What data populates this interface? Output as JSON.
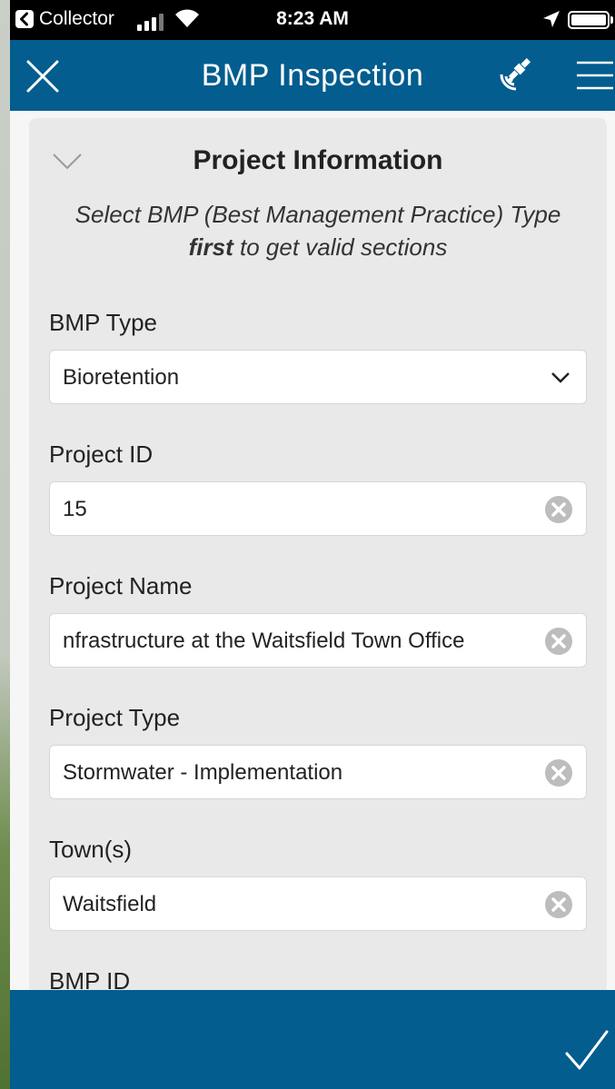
{
  "status_bar": {
    "back_app": "Collector",
    "time": "8:23 AM"
  },
  "nav": {
    "title": "BMP Inspection",
    "close_icon": "close-icon",
    "gps_icon": "gps-satellite-icon",
    "menu_icon": "hamburger-menu-icon",
    "color": "#035d8e"
  },
  "section": {
    "title": "Project Information",
    "instructions_prefix": "Select BMP (Best Management Practice) Type",
    "instructions_bold": "first",
    "instructions_suffix": " to get valid sections"
  },
  "fields": {
    "bmp_type": {
      "label": "BMP Type",
      "value": "Bioretention"
    },
    "project_id": {
      "label": "Project ID",
      "value": "15"
    },
    "project_name": {
      "label": "Project Name",
      "value": "nfrastructure at the Waitsfield Town Office"
    },
    "project_type": {
      "label": "Project Type",
      "value": "Stormwater - Implementation"
    },
    "towns": {
      "label": "Town(s)",
      "value": "Waitsfield"
    },
    "bmp_id": {
      "label": "BMP ID",
      "value": ""
    }
  },
  "bottom_bar": {
    "submit_icon": "checkmark-icon"
  }
}
